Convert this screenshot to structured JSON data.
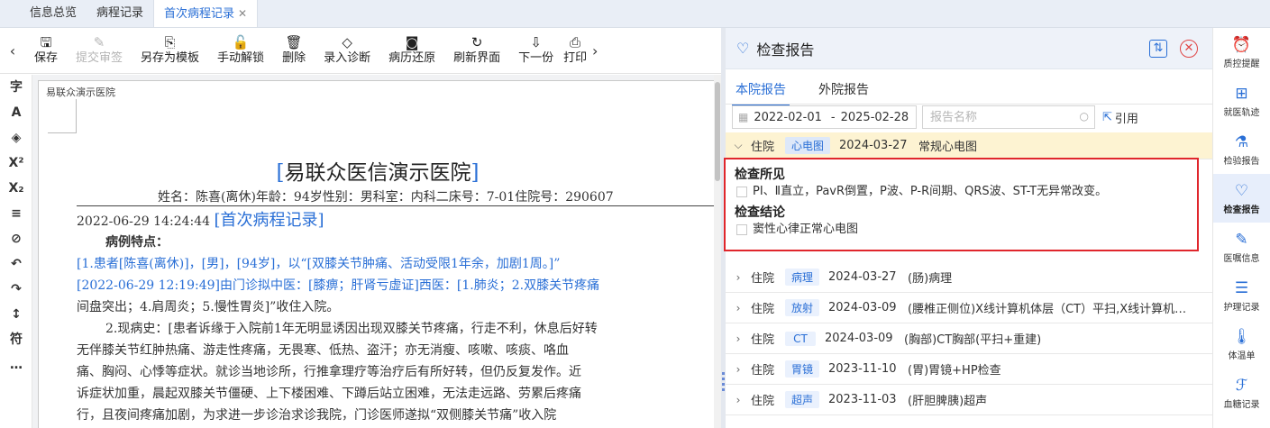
{
  "tabs": [
    {
      "label": "信息总览"
    },
    {
      "label": "病程记录"
    },
    {
      "label": "首次病程记录"
    }
  ],
  "toolbar": {
    "buttons": [
      {
        "label": "保存",
        "icon": "save-icon",
        "glyph": "🖫",
        "disabled": false
      },
      {
        "label": "提交审签",
        "icon": "submit-sign-icon",
        "glyph": "✎",
        "disabled": true
      },
      {
        "label": "另存为模板",
        "icon": "save-template-icon",
        "glyph": "⎘",
        "disabled": false
      },
      {
        "label": "手动解锁",
        "icon": "unlock-icon",
        "glyph": "🔓",
        "disabled": false
      },
      {
        "label": "删除",
        "icon": "delete-icon",
        "glyph": "🗑",
        "disabled": false
      },
      {
        "label": "录入诊断",
        "icon": "diagnosis-icon",
        "glyph": "◇",
        "disabled": false
      },
      {
        "label": "病历还原",
        "icon": "restore-icon",
        "glyph": "◙",
        "disabled": false
      },
      {
        "label": "刷新界面",
        "icon": "refresh-icon",
        "glyph": "↻",
        "disabled": false
      },
      {
        "label": "下一份",
        "icon": "next-doc-icon",
        "glyph": "⇩",
        "disabled": false
      },
      {
        "label": "打印",
        "icon": "print-icon",
        "glyph": "⎙",
        "disabled": false
      }
    ]
  },
  "format_bar": [
    {
      "glyph": "字",
      "icon": "font-icon"
    },
    {
      "glyph": "A",
      "icon": "font-color-icon"
    },
    {
      "glyph": "◈",
      "icon": "fill-color-icon"
    },
    {
      "glyph": "X²",
      "icon": "superscript-icon"
    },
    {
      "glyph": "X₂",
      "icon": "subscript-icon"
    },
    {
      "glyph": "≡",
      "icon": "align-icon"
    },
    {
      "glyph": "⊘",
      "icon": "clear-format-icon"
    },
    {
      "glyph": "↶",
      "icon": "undo-icon"
    },
    {
      "glyph": "↷",
      "icon": "redo-icon"
    },
    {
      "glyph": "↕",
      "icon": "line-spacing-icon"
    },
    {
      "glyph": "符",
      "icon": "symbol-icon"
    },
    {
      "glyph": "…",
      "icon": "more-icon"
    }
  ],
  "document": {
    "header_hospital": "易联众演示医院",
    "title": "易联众医信演示医院",
    "patient_line": "姓名：陈喜(离休)年龄：94岁性别：男科室：内科二床号：7-01住院号：290607",
    "record_datetime": "2022-06-29 14:24:44",
    "record_title": "首次病程记录",
    "section_features": "病例特点：",
    "lines": [
      "[1.患者[陈喜(离休)]，[男]，[94岁]，以“[双膝关节肿痛、活动受限1年余，加剧1周。]”",
      "[2022-06-29 12:19:49]由门诊拟中医：[膝痹；肝肾亏虚证]西医：[1.肺炎；2.双膝关节疼痛",
      "间盘突出；4.肩周炎；5.慢性胃炎]”收住入院。",
      "2.现病史：[患者诉缘于入院前1年无明显诱因出现双膝关节疼痛，行走不利，休息后好转",
      "无伴膝关节红肿热痛、游走性疼痛，无畏寒、低热、盗汗；亦无消瘦、咳嗽、咳痰、咯血",
      "痛、胸闷、心悸等症状。就诊当地诊所，行推拿理疗等治疗后有所好转，但仍反复发作。近",
      "诉症状加重，晨起双膝关节僵硬、上下楼困难、下蹲后站立困难，无法走远路、劳累后疼痛",
      "行，且夜间疼痛加剧，为求进一步诊治求诊我院，门诊医师遂拟“双侧膝关节痛”收入院"
    ]
  },
  "report_panel": {
    "title": "检查报告",
    "tabs": [
      {
        "label": "本院报告",
        "active": true
      },
      {
        "label": "外院报告",
        "active": false
      }
    ],
    "date_from": "2022-02-01",
    "date_sep": "-",
    "date_to": "2025-02-28",
    "search_placeholder": "报告名称",
    "quote_label": "引用",
    "rows": [
      {
        "loc": "住院",
        "tag": "心电图",
        "date": "2024-03-27",
        "name": "常规心电图",
        "expanded": true
      },
      {
        "loc": "住院",
        "tag": "病理",
        "date": "2024-03-27",
        "name": "(肠)病理",
        "expanded": false
      },
      {
        "loc": "住院",
        "tag": "放射",
        "date": "2024-03-09",
        "name": "(腰椎正侧位)X线计算机体层（CT）平扫,X线计算机体层",
        "expanded": false
      },
      {
        "loc": "住院",
        "tag": "CT",
        "date": "2024-03-09",
        "name": "(胸部)CT胸部(平扫+重建)",
        "expanded": false
      },
      {
        "loc": "住院",
        "tag": "胃镜",
        "date": "2023-11-10",
        "name": "(胃)胃镜+HP检查",
        "expanded": false
      },
      {
        "loc": "住院",
        "tag": "超声",
        "date": "2023-11-03",
        "name": "(肝胆脾胰)超声",
        "expanded": false
      }
    ],
    "detail": {
      "findings_title": "检查所见",
      "findings": "PⅠ、Ⅱ直立，PavR倒置，P波、P-R间期、QRS波、ST-T无异常改变。",
      "conclusion_title": "检查结论",
      "conclusion": "窦性心律正常心电图"
    }
  },
  "right_nav": [
    {
      "label": "质控提醒",
      "icon": "alarm-icon",
      "glyph": "⏰",
      "active": false
    },
    {
      "label": "就医轨迹",
      "icon": "medical-track-icon",
      "glyph": "⊞",
      "active": false
    },
    {
      "label": "检验报告",
      "icon": "flask-icon",
      "glyph": "⚗",
      "active": false
    },
    {
      "label": "检查报告",
      "icon": "heart-icon",
      "glyph": "♡",
      "active": true
    },
    {
      "label": "医嘱信息",
      "icon": "order-icon",
      "glyph": "✎",
      "active": false
    },
    {
      "label": "护理记录",
      "icon": "nursing-icon",
      "glyph": "☰",
      "active": false
    },
    {
      "label": "体温单",
      "icon": "thermometer-icon",
      "glyph": "🌡",
      "active": false
    },
    {
      "label": "血糖记录",
      "icon": "blood-sugar-icon",
      "glyph": "ℱ",
      "active": false
    }
  ]
}
